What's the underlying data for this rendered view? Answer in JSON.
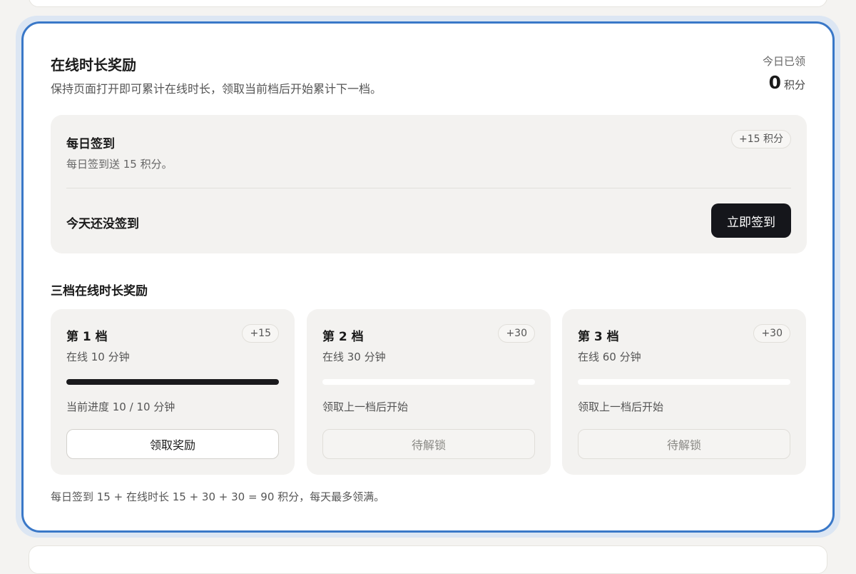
{
  "card": {
    "title": "在线时长奖励",
    "description": "保持页面打开即可累计在线时长，领取当前档后开始累计下一档。",
    "today_label": "今日已领",
    "today_value": "0",
    "today_unit": "积分"
  },
  "checkin": {
    "title": "每日签到",
    "description": "每日签到送 15 积分。",
    "badge": "+15 积分",
    "status": "今天还没签到",
    "button": "立即签到"
  },
  "tiers_title": "三档在线时长奖励",
  "tiers": [
    {
      "name": "第 1 档",
      "badge": "+15",
      "requirement": "在线 10 分钟",
      "progress": 1.0,
      "status": "当前进度 10 / 10 分钟",
      "button": "领取奖励",
      "locked": false
    },
    {
      "name": "第 2 档",
      "badge": "+30",
      "requirement": "在线 30 分钟",
      "progress": 0.0,
      "status": "领取上一档后开始",
      "button": "待解锁",
      "locked": true
    },
    {
      "name": "第 3 档",
      "badge": "+30",
      "requirement": "在线 60 分钟",
      "progress": 0.0,
      "status": "领取上一档后开始",
      "button": "待解锁",
      "locked": true
    }
  ],
  "footer_note": "每日签到 15 + 在线时长 15 + 30 + 30 = 90 积分，每天最多领满。",
  "colors": {
    "accent_border": "#3a78c8",
    "primary_button": "#15161b"
  }
}
